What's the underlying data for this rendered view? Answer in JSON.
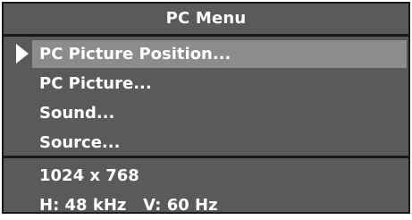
{
  "menu": {
    "title": "PC Menu",
    "items": [
      {
        "label": "PC Picture Position...",
        "selected": true
      },
      {
        "label": "PC Picture...",
        "selected": false
      },
      {
        "label": "Sound...",
        "selected": false
      },
      {
        "label": "Source...",
        "selected": false
      }
    ],
    "selection_icon": "triangle-pointer-icon"
  },
  "info": {
    "resolution": "1024 x 768",
    "frequency": "H: 48 kHz   V: 60 Hz"
  },
  "colors": {
    "panel": "#5a5a5a",
    "highlight": "#8c8c8c",
    "border": "#1a1a1a",
    "text": "#ffffff"
  }
}
